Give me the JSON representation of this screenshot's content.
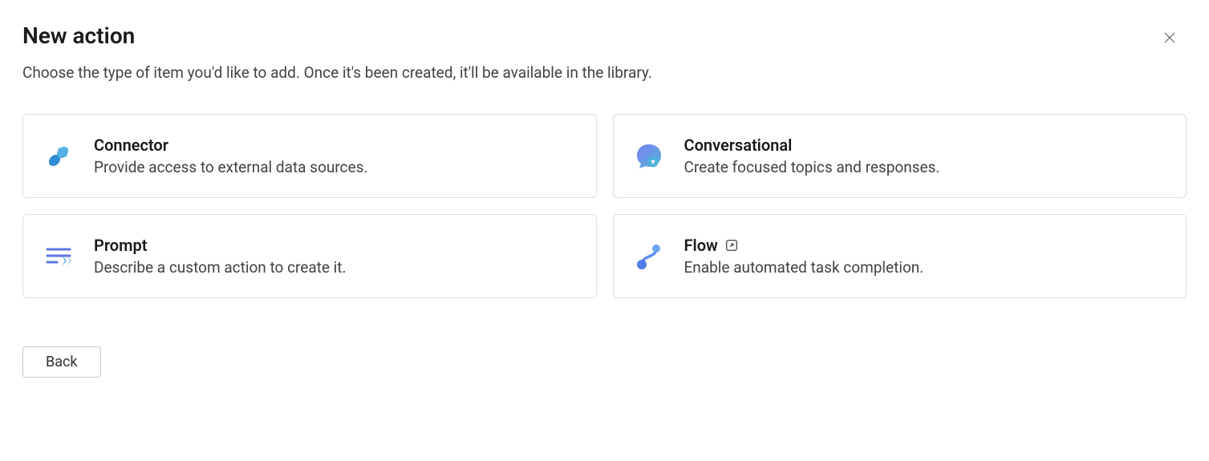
{
  "header": {
    "title": "New action",
    "subtitle": "Choose the type of item you'd like to add. Once it's been created, it'll be available in the library."
  },
  "cards": {
    "connector": {
      "title": "Connector",
      "desc": "Provide access to external data sources."
    },
    "conversational": {
      "title": "Conversational",
      "desc": "Create focused topics and responses."
    },
    "prompt": {
      "title": "Prompt",
      "desc": "Describe a custom action to create it."
    },
    "flow": {
      "title": "Flow",
      "desc": "Enable automated task completion."
    }
  },
  "footer": {
    "back_label": "Back"
  }
}
